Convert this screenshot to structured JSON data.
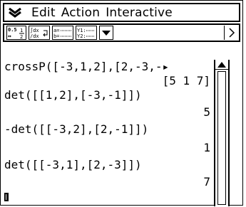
{
  "menubar": {
    "chevron_icon": "chevron-down-double-icon",
    "items": [
      "Edit",
      "Action",
      "Interactive"
    ]
  },
  "toolbar": {
    "buttons": [
      {
        "icon": "fraction-decimal-toggle-icon",
        "text": "0.5 1\n↔2"
      },
      {
        "icon": "integral-derivative-icon",
        "text": "∫dx\n/dx"
      },
      {
        "icon": "assignment-icon",
        "text": "a=…\nb=…"
      },
      {
        "icon": "graph-function-icon",
        "text": "Y1:…\nY2:…"
      },
      {
        "icon": "dropdown-arrow-icon",
        "text": ""
      }
    ],
    "scroll_icon": "chevron-right-icon"
  },
  "work": {
    "lines": [
      {
        "type": "input",
        "text": "crossP([-3,1,2],[2,-3,-▸"
      },
      {
        "type": "output",
        "text": "[5 1 7]"
      },
      {
        "type": "input",
        "text": "det([[1,2],[-3,-1]])"
      },
      {
        "type": "output",
        "text": "5"
      },
      {
        "type": "input",
        "text": "-det([[-3,2],[2,-1]])"
      },
      {
        "type": "output",
        "text": "1"
      },
      {
        "type": "input",
        "text": "det([[-3,1],[2,-3]])"
      },
      {
        "type": "output",
        "text": "7"
      }
    ]
  }
}
